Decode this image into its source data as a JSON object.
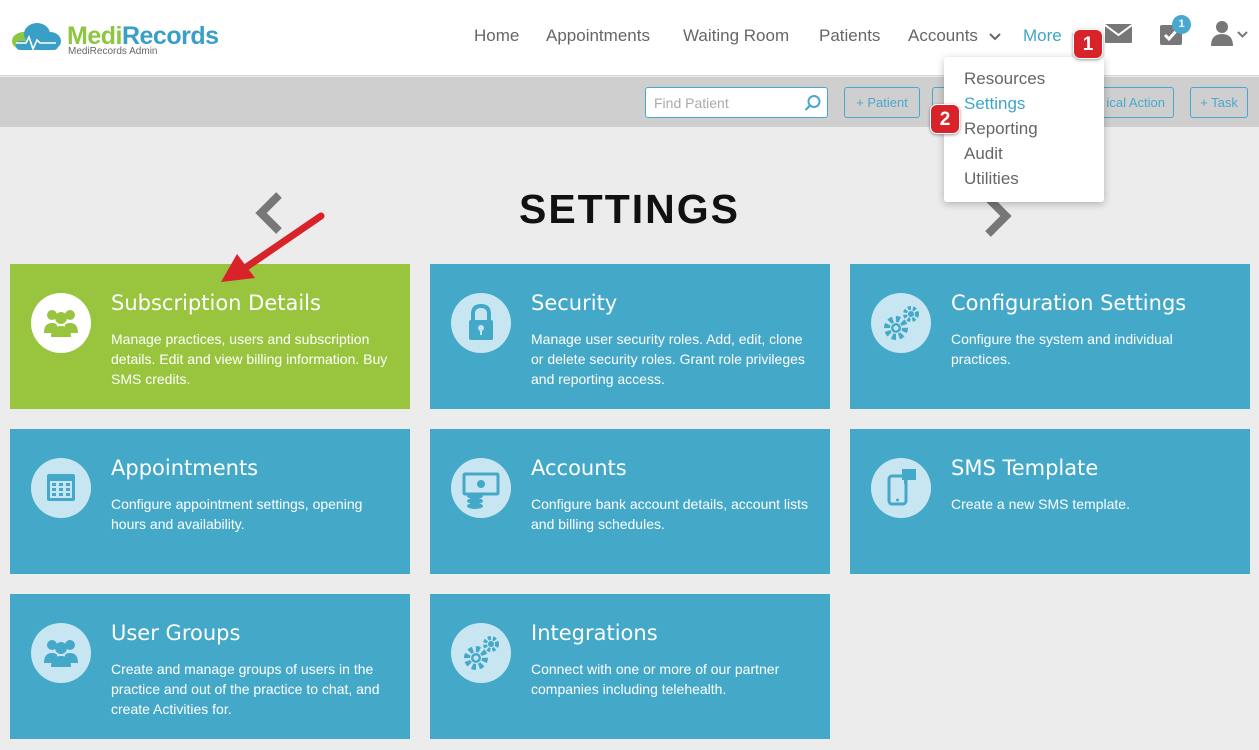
{
  "app": {
    "name_part1": "Medi",
    "name_part2": "Records",
    "subtitle": "MediRecords Admin"
  },
  "nav": {
    "items": [
      {
        "label": "Home"
      },
      {
        "label": "Appointments"
      },
      {
        "label": "Waiting Room"
      },
      {
        "label": "Patients"
      },
      {
        "label": "Accounts"
      },
      {
        "label": "More"
      }
    ],
    "tasks_badge": "1"
  },
  "toolbar": {
    "search_placeholder": "Find Patient",
    "patient_button": "+ Patient",
    "clinical_action_button": "ical Action",
    "task_button": "+ Task"
  },
  "dropdown": {
    "items": [
      {
        "label": "Resources"
      },
      {
        "label": "Settings"
      },
      {
        "label": "Reporting"
      },
      {
        "label": "Audit"
      },
      {
        "label": "Utilities"
      }
    ]
  },
  "annotations": {
    "step1": "1",
    "step2": "2"
  },
  "page": {
    "title": "SETTINGS"
  },
  "tiles": [
    {
      "title": "Subscription Details",
      "description": "Manage practices, users and subscription details. Edit and view billing information. Buy SMS credits.",
      "icon": "users-icon"
    },
    {
      "title": "Security",
      "description": "Manage user security roles. Add, edit, clone or delete security roles. Grant role privileges and reporting access.",
      "icon": "lock-icon"
    },
    {
      "title": "Configuration Settings",
      "description": "Configure the system and individual practices.",
      "icon": "gears-icon"
    },
    {
      "title": "Appointments",
      "description": "Configure appointment settings, opening hours and availability.",
      "icon": "calendar-icon"
    },
    {
      "title": "Accounts",
      "description": "Configure bank account details, account lists and billing schedules.",
      "icon": "money-icon"
    },
    {
      "title": "SMS Template",
      "description": "Create a new SMS template.",
      "icon": "phone-message-icon"
    },
    {
      "title": "User Groups",
      "description": "Create and manage groups of users in the practice and out of the practice to chat, and create Activities for.",
      "icon": "user-group-icon"
    },
    {
      "title": "Integrations",
      "description": "Connect with one or more of our partner companies including telehealth.",
      "icon": "gears-icon"
    }
  ],
  "colors": {
    "brand_green": "#8dc63f",
    "brand_blue": "#3a9fc7",
    "tile_blue": "#44a8c9",
    "tile_green": "#98c43e",
    "annotation_red": "#d8232a"
  }
}
